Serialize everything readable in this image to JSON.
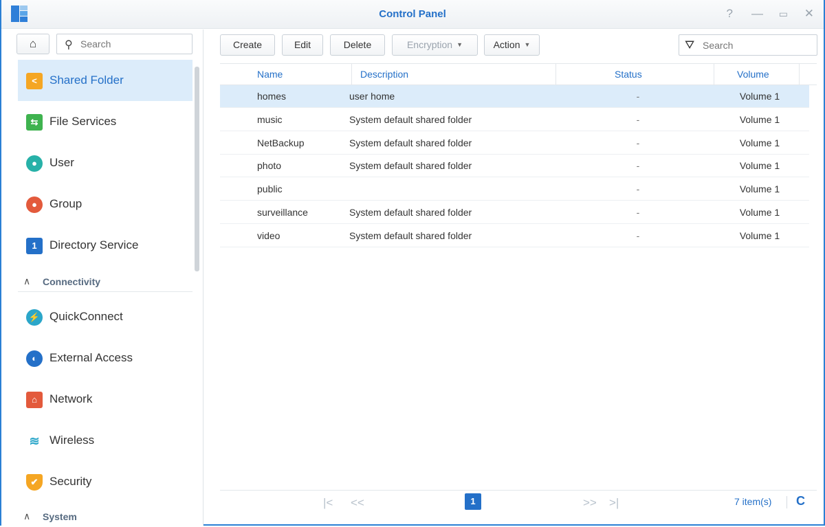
{
  "window": {
    "title": "Control Panel",
    "controls": {
      "help": "?",
      "minimize": "—",
      "maximize": "▭",
      "close": "✕"
    }
  },
  "sidebar": {
    "home_icon": "⌂",
    "search": {
      "placeholder": "Search",
      "icon": "⚲"
    },
    "items": [
      {
        "label": "Shared Folder",
        "icon": "shared-folder-icon",
        "glyph": "<",
        "color": "#f5a623",
        "active": true
      },
      {
        "label": "File Services",
        "icon": "file-services-icon",
        "glyph": "⇆",
        "color": "#3fb34f"
      },
      {
        "label": "User",
        "icon": "user-icon",
        "glyph": "●",
        "color": "#27b1a8"
      },
      {
        "label": "Group",
        "icon": "group-icon",
        "glyph": "●",
        "color": "#e35a3c"
      },
      {
        "label": "Directory Service",
        "icon": "directory-service-icon",
        "glyph": "1",
        "color": "#2470c8"
      }
    ],
    "sections": [
      {
        "label": "Connectivity",
        "chevron": "∧"
      },
      {
        "label": "System",
        "chevron": "∧"
      }
    ],
    "connectivity_items": [
      {
        "label": "QuickConnect",
        "icon": "quickconnect-icon",
        "glyph": "⚡",
        "color": "#2ba6c9"
      },
      {
        "label": "External Access",
        "icon": "external-access-icon",
        "glyph": "◐",
        "color": "#2470c8"
      },
      {
        "label": "Network",
        "icon": "network-icon",
        "glyph": "⌂",
        "color": "#e35a3c"
      },
      {
        "label": "Wireless",
        "icon": "wireless-icon",
        "glyph": "≋",
        "color": "#2ba6c9"
      },
      {
        "label": "Security",
        "icon": "security-icon",
        "glyph": "✔",
        "color": "#f5a623"
      }
    ]
  },
  "toolbar": {
    "create": "Create",
    "edit": "Edit",
    "delete": "Delete",
    "encryption": "Encryption",
    "action": "Action",
    "caret": "▼",
    "search_placeholder": "Search",
    "filter_icon": "⛛"
  },
  "table": {
    "columns": [
      "Name",
      "Description",
      "Status",
      "Volume"
    ],
    "rows": [
      {
        "name": "homes",
        "description": "user home",
        "status": "-",
        "volume": "Volume 1",
        "selected": true
      },
      {
        "name": "music",
        "description": "System default shared folder",
        "status": "-",
        "volume": "Volume 1"
      },
      {
        "name": "NetBackup",
        "description": "System default shared folder",
        "status": "-",
        "volume": "Volume 1"
      },
      {
        "name": "photo",
        "description": "System default shared folder",
        "status": "-",
        "volume": "Volume 1"
      },
      {
        "name": "public",
        "description": "",
        "status": "-",
        "volume": "Volume 1"
      },
      {
        "name": "surveillance",
        "description": "System default shared folder",
        "status": "-",
        "volume": "Volume 1"
      },
      {
        "name": "video",
        "description": "System default shared folder",
        "status": "-",
        "volume": "Volume 1"
      }
    ]
  },
  "pager": {
    "first": "|<",
    "prev": "<<",
    "current_page": "1",
    "next": ">>",
    "last": ">|",
    "count": "7 item(s)",
    "refresh": "C"
  },
  "colors": {
    "accent": "#2470c8",
    "selected_row": "#dcecfa",
    "window_border": "#2a7fd4"
  }
}
